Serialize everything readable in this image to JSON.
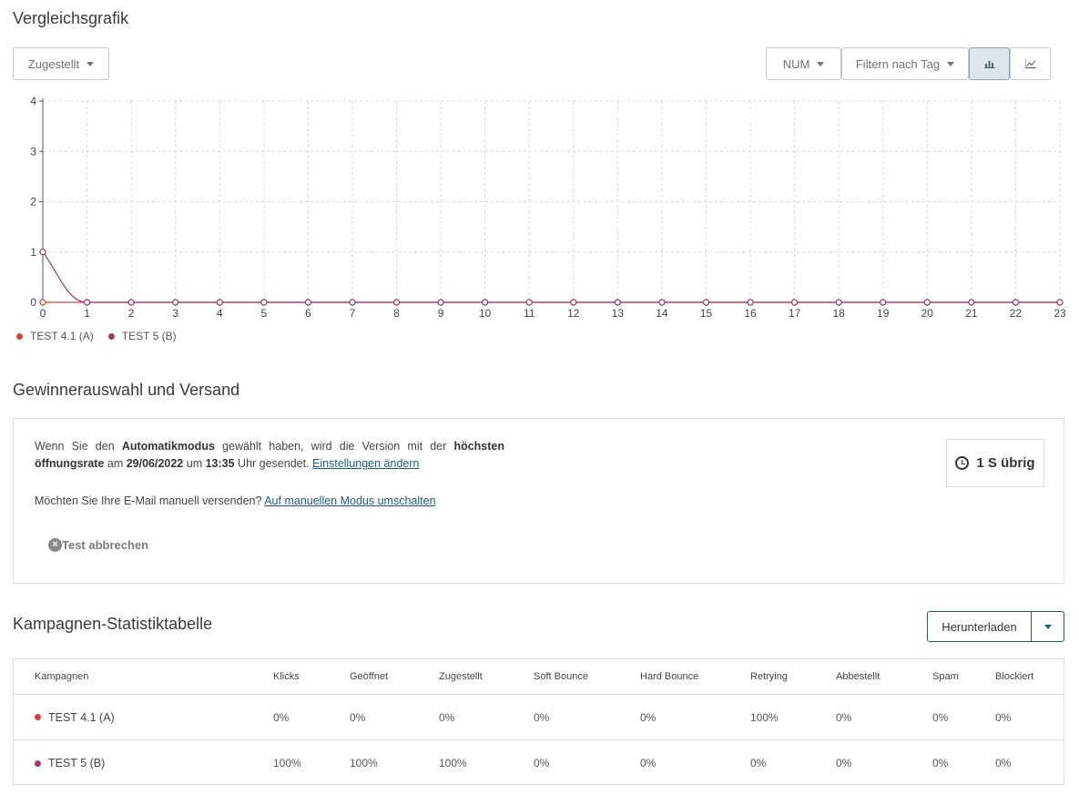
{
  "sections": {
    "chart_title": "Vergleichsgrafik",
    "winner_title": "Gewinnerauswahl und Versand",
    "stats_title": "Kampagnen-Statistiktabelle"
  },
  "toolbar": {
    "metric_dropdown": "Zugestellt",
    "num_dropdown": "NUM",
    "tag_filter": "Filtern nach Tag",
    "bar_icon": "bar-chart-icon",
    "line_icon": "line-chart-icon"
  },
  "chart_data": {
    "type": "line",
    "x": [
      0,
      1,
      2,
      3,
      4,
      5,
      6,
      7,
      8,
      9,
      10,
      11,
      12,
      13,
      14,
      15,
      16,
      17,
      18,
      19,
      20,
      21,
      22,
      23
    ],
    "xlim": [
      0,
      23
    ],
    "ylim": [
      0,
      4
    ],
    "yticks": [
      0,
      1,
      2,
      3,
      4
    ],
    "grid": true,
    "legend_position": "bottom-left",
    "series": [
      {
        "name": "TEST 4.1 (A)",
        "color": "#d2403a",
        "values": [
          0,
          0,
          0,
          0,
          0,
          0,
          0,
          0,
          0,
          0,
          0,
          0,
          0,
          0,
          0,
          0,
          0,
          0,
          0,
          0,
          0,
          0,
          0,
          0
        ]
      },
      {
        "name": "TEST 5 (B)",
        "color": "#9c3a6a",
        "values": [
          1,
          0,
          0,
          0,
          0,
          0,
          0,
          0,
          0,
          0,
          0,
          0,
          0,
          0,
          0,
          0,
          0,
          0,
          0,
          0,
          0,
          0,
          0,
          0
        ]
      }
    ]
  },
  "winner": {
    "text1_a": "Wenn Sie den ",
    "text1_b": "Automatikmodus",
    "text1_c": " gewählt haben, wird die Version mit der ",
    "text1_d": "höchsten öffnungsrate",
    "text1_e": " am ",
    "text1_f": "29/06/2022",
    "text1_g": " um ",
    "text1_h": "13:35",
    "text1_i": " Uhr gesendet. ",
    "settings_link": "Einstellungen ändern",
    "text2": "Möchten Sie Ihre E-Mail manuell versenden? ",
    "manual_link": "Auf manuellen Modus umschalten",
    "cancel_label": "Test abbrechen",
    "timer_label": "1 S übrig"
  },
  "download": {
    "label": "Herunterladen"
  },
  "table": {
    "headers": [
      "Kampagnen",
      "Klicks",
      "Geöffnet",
      "Zugestellt",
      "Soft Bounce",
      "Hard Bounce",
      "Retrying",
      "Abbestellt",
      "Spam",
      "Blockiert"
    ],
    "rows": [
      {
        "name": "TEST 4.1 (A)",
        "color": "#d2403a",
        "cells": [
          "0%",
          "0%",
          "0%",
          "0%",
          "0%",
          "100%",
          "0%",
          "0%",
          "0%"
        ]
      },
      {
        "name": "TEST 5 (B)",
        "color": "#9c3a6a",
        "cells": [
          "100%",
          "100%",
          "100%",
          "0%",
          "0%",
          "0%",
          "0%",
          "0%",
          "0%"
        ]
      }
    ]
  }
}
